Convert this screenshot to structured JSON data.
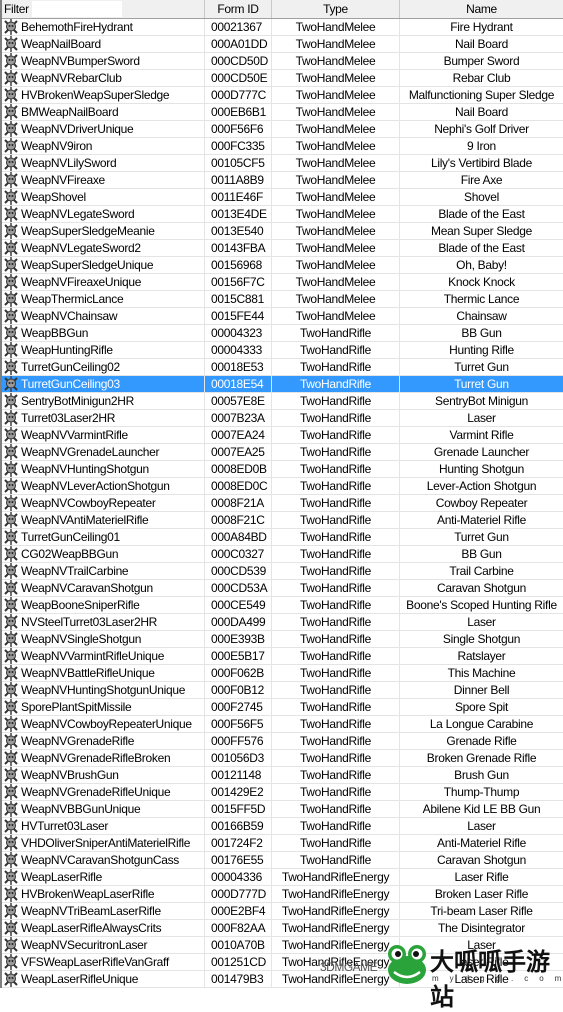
{
  "filter": {
    "label": "Filter",
    "value": ""
  },
  "columns": [
    "",
    "Form ID",
    "Type",
    "Name"
  ],
  "selected_index": 21,
  "colors": {
    "selection": "#3399ff",
    "header": "#f0f0f0"
  },
  "row_icon": "weapon-skull-icon",
  "rows": [
    [
      "BehemothFireHydrant",
      "00021367",
      "TwoHandMelee",
      "Fire Hydrant"
    ],
    [
      "WeapNailBoard",
      "000A01DD",
      "TwoHandMelee",
      "Nail Board"
    ],
    [
      "WeapNVBumperSword",
      "000CD50D",
      "TwoHandMelee",
      "Bumper Sword"
    ],
    [
      "WeapNVRebarClub",
      "000CD50E",
      "TwoHandMelee",
      "Rebar Club"
    ],
    [
      "HVBrokenWeapSuperSledge",
      "000D777C",
      "TwoHandMelee",
      "Malfunctioning Super Sledge"
    ],
    [
      "BMWeapNailBoard",
      "000EB6B1",
      "TwoHandMelee",
      "Nail Board"
    ],
    [
      "WeapNVDriverUnique",
      "000F56F6",
      "TwoHandMelee",
      "Nephi's Golf Driver"
    ],
    [
      "WeapNV9iron",
      "000FC335",
      "TwoHandMelee",
      "9 Iron"
    ],
    [
      "WeapNVLilySword",
      "00105CF5",
      "TwoHandMelee",
      "Lily's Vertibird Blade"
    ],
    [
      "WeapNVFireaxe",
      "0011A8B9",
      "TwoHandMelee",
      "Fire Axe"
    ],
    [
      "WeapShovel",
      "0011E46F",
      "TwoHandMelee",
      "Shovel"
    ],
    [
      "WeapNVLegateSword",
      "0013E4DE",
      "TwoHandMelee",
      "Blade of the East"
    ],
    [
      "WeapSuperSledgeMeanie",
      "0013E540",
      "TwoHandMelee",
      "Mean Super Sledge"
    ],
    [
      "WeapNVLegateSword2",
      "00143FBA",
      "TwoHandMelee",
      "Blade of the East"
    ],
    [
      "WeapSuperSledgeUnique",
      "00156968",
      "TwoHandMelee",
      "Oh, Baby!"
    ],
    [
      "WeapNVFireaxeUnique",
      "00156F7C",
      "TwoHandMelee",
      "Knock Knock"
    ],
    [
      "WeapThermicLance",
      "0015C881",
      "TwoHandMelee",
      "Thermic Lance"
    ],
    [
      "WeapNVChainsaw",
      "0015FE44",
      "TwoHandMelee",
      "Chainsaw"
    ],
    [
      "WeapBBGun",
      "00004323",
      "TwoHandRifle",
      "BB Gun"
    ],
    [
      "WeapHuntingRifle",
      "00004333",
      "TwoHandRifle",
      "Hunting Rifle"
    ],
    [
      "TurretGunCeiling02",
      "00018E53",
      "TwoHandRifle",
      "Turret Gun"
    ],
    [
      "TurretGunCeiling03",
      "00018E54",
      "TwoHandRifle",
      "Turret Gun"
    ],
    [
      "SentryBotMinigun2HR",
      "00057E8E",
      "TwoHandRifle",
      "SentryBot Minigun"
    ],
    [
      "Turret03Laser2HR",
      "0007B23A",
      "TwoHandRifle",
      "Laser"
    ],
    [
      "WeapNVVarmintRifle",
      "0007EA24",
      "TwoHandRifle",
      "Varmint Rifle"
    ],
    [
      "WeapNVGrenadeLauncher",
      "0007EA25",
      "TwoHandRifle",
      "Grenade Launcher"
    ],
    [
      "WeapNVHuntingShotgun",
      "0008ED0B",
      "TwoHandRifle",
      "Hunting Shotgun"
    ],
    [
      "WeapNVLeverActionShotgun",
      "0008ED0C",
      "TwoHandRifle",
      "Lever-Action Shotgun"
    ],
    [
      "WeapNVCowboyRepeater",
      "0008F21A",
      "TwoHandRifle",
      "Cowboy Repeater"
    ],
    [
      "WeapNVAntiMaterielRifle",
      "0008F21C",
      "TwoHandRifle",
      "Anti-Materiel Rifle"
    ],
    [
      "TurretGunCeiling01",
      "000A84BD",
      "TwoHandRifle",
      "Turret Gun"
    ],
    [
      "CG02WeapBBGun",
      "000C0327",
      "TwoHandRifle",
      "BB Gun"
    ],
    [
      "WeapNVTrailCarbine",
      "000CD539",
      "TwoHandRifle",
      "Trail Carbine"
    ],
    [
      "WeapNVCaravanShotgun",
      "000CD53A",
      "TwoHandRifle",
      "Caravan Shotgun"
    ],
    [
      "WeapBooneSniperRifle",
      "000CE549",
      "TwoHandRifle",
      "Boone's Scoped Hunting Rifle"
    ],
    [
      "NVSteelTurret03Laser2HR",
      "000DA499",
      "TwoHandRifle",
      "Laser"
    ],
    [
      "WeapNVSingleShotgun",
      "000E393B",
      "TwoHandRifle",
      "Single Shotgun"
    ],
    [
      "WeapNVVarmintRifleUnique",
      "000E5B17",
      "TwoHandRifle",
      "Ratslayer"
    ],
    [
      "WeapNVBattleRifleUnique",
      "000F062B",
      "TwoHandRifle",
      "This Machine"
    ],
    [
      "WeapNVHuntingShotgunUnique",
      "000F0B12",
      "TwoHandRifle",
      "Dinner Bell"
    ],
    [
      "SporePlantSpitMissile",
      "000F2745",
      "TwoHandRifle",
      "Spore Spit"
    ],
    [
      "WeapNVCowboyRepeaterUnique",
      "000F56F5",
      "TwoHandRifle",
      "La Longue Carabine"
    ],
    [
      "WeapNVGrenadeRifle",
      "000FF576",
      "TwoHandRifle",
      "Grenade Rifle"
    ],
    [
      "WeapNVGrenadeRifleBroken",
      "001056D3",
      "TwoHandRifle",
      "Broken Grenade Rifle"
    ],
    [
      "WeapNVBrushGun",
      "00121148",
      "TwoHandRifle",
      "Brush Gun"
    ],
    [
      "WeapNVGrenadeRifleUnique",
      "001429E2",
      "TwoHandRifle",
      "Thump-Thump"
    ],
    [
      "WeapNVBBGunUnique",
      "0015FF5D",
      "TwoHandRifle",
      "Abilene Kid LE BB Gun"
    ],
    [
      "HVTurret03Laser",
      "00166B59",
      "TwoHandRifle",
      "Laser"
    ],
    [
      "VHDOliverSniperAntiMaterielRifle",
      "001724F2",
      "TwoHandRifle",
      "Anti-Materiel Rifle"
    ],
    [
      "WeapNVCaravanShotgunCass",
      "00176E55",
      "TwoHandRifle",
      "Caravan Shotgun"
    ],
    [
      "WeapLaserRifle",
      "00004336",
      "TwoHandRifleEnergy",
      "Laser Rifle"
    ],
    [
      "HVBrokenWeapLaserRifle",
      "000D777D",
      "TwoHandRifleEnergy",
      "Broken Laser Rifle"
    ],
    [
      "WeapNVTriBeamLaserRifle",
      "000E2BF4",
      "TwoHandRifleEnergy",
      "Tri-beam Laser Rifle"
    ],
    [
      "WeapLaserRifleAlwaysCrits",
      "000F82AA",
      "TwoHandRifleEnergy",
      "The Disintegrator"
    ],
    [
      "WeapNVSecuritronLaser",
      "0010A70B",
      "TwoHandRifleEnergy",
      "Laser"
    ],
    [
      "VFSWeapLaserRifleVanGraff",
      "001251CD",
      "TwoHandRifleEnergy",
      "Laser Rifle"
    ],
    [
      "WeapLaserRifleUnique",
      "001479B3",
      "TwoHandRifleEnergy",
      "Laser Rifle"
    ]
  ],
  "watermark": {
    "brand": "3DMGAME",
    "title": "大呱呱手游站",
    "url": "mydgg.com"
  }
}
